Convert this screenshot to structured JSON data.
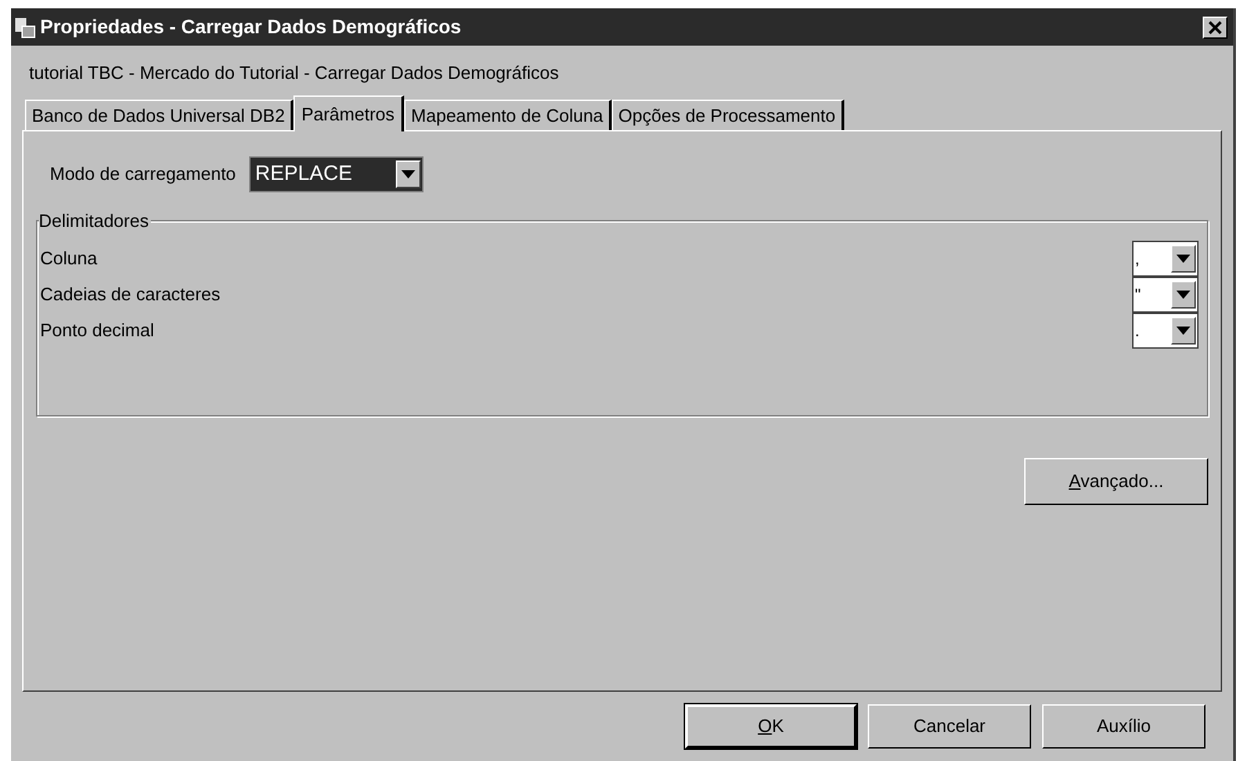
{
  "window": {
    "title": "Propriedades - Carregar Dados Demográficos"
  },
  "subtitle": "tutorial TBC - Mercado do Tutorial - Carregar Dados Demográficos",
  "tabs": [
    {
      "label": "Banco de Dados Universal DB2",
      "selected": false
    },
    {
      "label": "Parâmetros",
      "selected": true
    },
    {
      "label": "Mapeamento de Coluna",
      "selected": false
    },
    {
      "label": "Opções de Processamento",
      "selected": false
    }
  ],
  "load_mode": {
    "label": "Modo de carregamento",
    "value": "REPLACE"
  },
  "delimiters": {
    "title": "Delimitadores",
    "rows": [
      {
        "label": "Coluna",
        "value": ","
      },
      {
        "label": "Cadeias de caracteres",
        "value": "\""
      },
      {
        "label": "Ponto decimal",
        "value": "."
      }
    ]
  },
  "advanced_button": {
    "label": "Avançado...",
    "underline_first": true
  },
  "buttons": [
    {
      "label": "OK",
      "underline_first": true,
      "default": true
    },
    {
      "label": "Cancelar",
      "underline_first": false,
      "default": false
    },
    {
      "label": "Auxílio",
      "underline_first": false,
      "default": false
    }
  ]
}
